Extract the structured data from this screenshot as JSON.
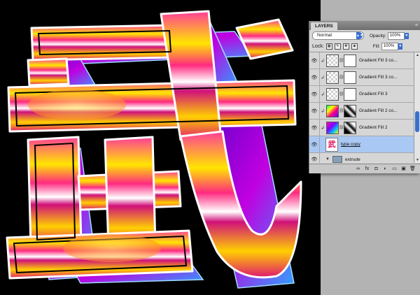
{
  "artwork": {
    "glyph": "武",
    "colors": {
      "magenta": "#e0186e",
      "orange": "#ff7a1a",
      "yellow": "#ffe000",
      "violet": "#8a1cf0",
      "cyan": "#40c8ff"
    }
  },
  "panel": {
    "tab_label": "LAYERS",
    "menu_icon": "≡",
    "blend_mode": "Normal",
    "opacity_label": "Opacity:",
    "opacity_value": "100%",
    "lock_label": "Lock:",
    "fill_label": "Fill:",
    "fill_value": "100%",
    "layers": [
      {
        "name": "Gradient Fill 3 co...",
        "thumb": "checker",
        "mask": "mask",
        "selected": false
      },
      {
        "name": "Gradient Fill 3 co...",
        "thumb": "checker",
        "mask": "mask",
        "selected": false
      },
      {
        "name": "Gradient Fill 3",
        "thumb": "checker",
        "mask": "mask",
        "selected": false
      },
      {
        "name": "Gradient Fill 2 co...",
        "thumb": "grad1",
        "mask": "bwmask",
        "selected": false
      },
      {
        "name": "Gradient Fill 2",
        "thumb": "grad2",
        "mask": "bwmask",
        "selected": false
      },
      {
        "name": "type copy",
        "thumb": "type",
        "selected": true,
        "glyph": "武"
      },
      {
        "name": "extrude",
        "thumb": "folder",
        "selected": false
      }
    ],
    "bottom_icons": [
      "link-icon",
      "fx-icon",
      "mask-icon",
      "adjustment-icon",
      "folder-icon",
      "new-layer-icon",
      "trash-icon"
    ],
    "bottom_glyphs": [
      "∞",
      "fx",
      "◘",
      "◐",
      "▭",
      "▣",
      "🗑"
    ]
  }
}
